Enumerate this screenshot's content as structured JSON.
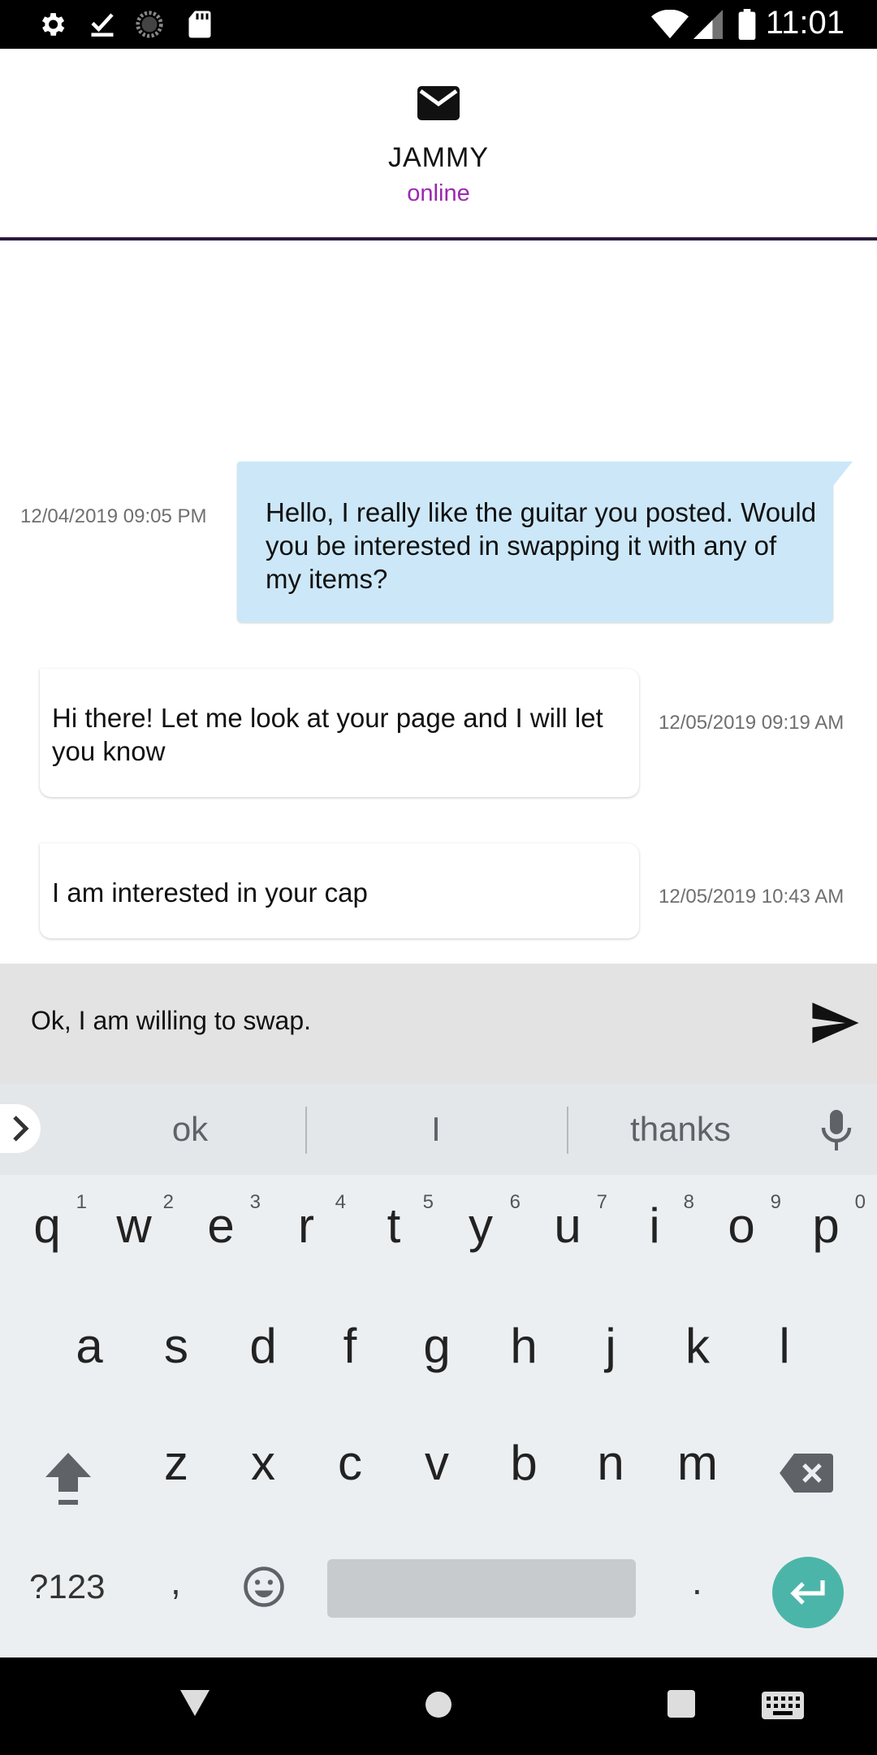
{
  "status_bar": {
    "time": "11:01",
    "left_icons": [
      "gear-icon",
      "checkmark-download-icon",
      "sync-circle-icon",
      "sd-card-icon"
    ],
    "right_icons": [
      "wifi-icon",
      "cell-signal-icon",
      "battery-icon"
    ]
  },
  "header": {
    "icon": "mail-icon",
    "contact_name": "JAMMY",
    "presence": "online",
    "presence_color": "#9c27b0"
  },
  "messages": [
    {
      "direction": "outgoing",
      "timestamp": "12/04/2019 09:05 PM",
      "text": "Hello, I really like the guitar you posted. Would you be interested in swapping it with any of my items?"
    },
    {
      "direction": "incoming",
      "timestamp": "12/05/2019 09:19 AM",
      "text": "Hi there! Let me look at your page and I will let you know"
    },
    {
      "direction": "incoming",
      "timestamp": "12/05/2019 10:43 AM",
      "text": "I am interested in your cap"
    }
  ],
  "composer": {
    "value": "Ok, I am willing to swap.",
    "send_icon": "send-icon"
  },
  "keyboard": {
    "suggestions": [
      "ok",
      "I",
      "thanks"
    ],
    "row1": [
      {
        "k": "q",
        "n": "1"
      },
      {
        "k": "w",
        "n": "2"
      },
      {
        "k": "e",
        "n": "3"
      },
      {
        "k": "r",
        "n": "4"
      },
      {
        "k": "t",
        "n": "5"
      },
      {
        "k": "y",
        "n": "6"
      },
      {
        "k": "u",
        "n": "7"
      },
      {
        "k": "i",
        "n": "8"
      },
      {
        "k": "o",
        "n": "9"
      },
      {
        "k": "p",
        "n": "0"
      }
    ],
    "row2": [
      "a",
      "s",
      "d",
      "f",
      "g",
      "h",
      "j",
      "k",
      "l"
    ],
    "row3": [
      "z",
      "x",
      "c",
      "v",
      "b",
      "n",
      "m"
    ],
    "symbols_label": "?123",
    "comma": ",",
    "period": ".",
    "enter_color": "#4cb5a9"
  },
  "colors": {
    "outgoing_bubble": "#cce8f8",
    "header_divider": "#2b1b3a",
    "composer_bg": "#e3e3e3"
  }
}
